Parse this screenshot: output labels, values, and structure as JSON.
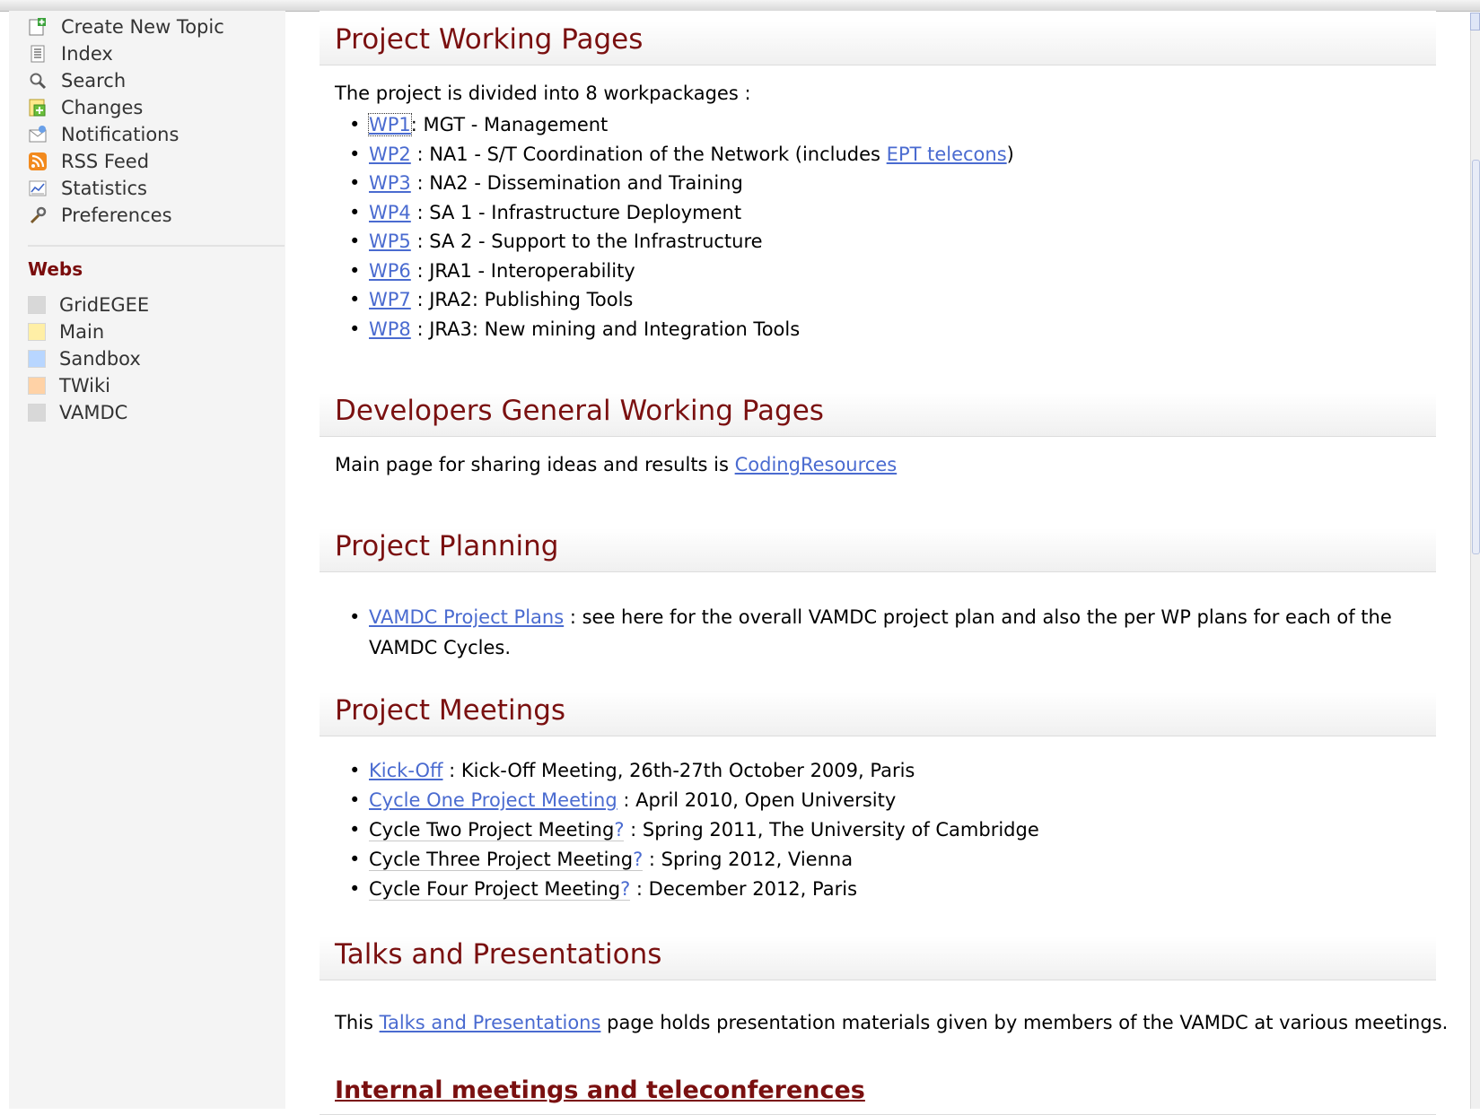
{
  "sidebar": {
    "tools": [
      {
        "label": "Create New Topic",
        "icon": "create-topic-icon"
      },
      {
        "label": "Index",
        "icon": "index-icon"
      },
      {
        "label": "Search",
        "icon": "search-icon"
      },
      {
        "label": "Changes",
        "icon": "changes-icon"
      },
      {
        "label": "Notifications",
        "icon": "notifications-icon"
      },
      {
        "label": "RSS Feed",
        "icon": "rss-icon"
      },
      {
        "label": "Statistics",
        "icon": "statistics-icon"
      },
      {
        "label": "Preferences",
        "icon": "wrench-icon"
      }
    ],
    "webs_title": "Webs",
    "webs": [
      {
        "label": "GridEGEE",
        "color": "#d8d8d8"
      },
      {
        "label": "Main",
        "color": "#ffefa6"
      },
      {
        "label": "Sandbox",
        "color": "#b8d6ff"
      },
      {
        "label": "TWiki",
        "color": "#ffd2a6"
      },
      {
        "label": "VAMDC",
        "color": "#d8d8d8"
      }
    ]
  },
  "sections": {
    "working": {
      "title": "Project Working Pages",
      "intro": "The project is divided into 8 workpackages :",
      "items": [
        {
          "link": "WP1",
          "text": ": MGT - Management"
        },
        {
          "link": "WP2",
          "text": " : NA1 - S/T Coordination of the Network (includes ",
          "link2": "EPT telecons",
          "text2": ")"
        },
        {
          "link": "WP3",
          "text": " : NA2 - Dissemination and Training"
        },
        {
          "link": "WP4",
          "text": " : SA 1 - Infrastructure Deployment"
        },
        {
          "link": "WP5",
          "text": " : SA 2 - Support to the Infrastructure"
        },
        {
          "link": "WP6",
          "text": " : JRA1 - Interoperability"
        },
        {
          "link": "WP7",
          "text": " : JRA2: Publishing Tools"
        },
        {
          "link": "WP8",
          "text": " : JRA3: New mining and Integration Tools"
        }
      ]
    },
    "developers": {
      "title": "Developers General Working Pages",
      "text": "Main page for sharing ideas and results is ",
      "link": "CodingResources"
    },
    "planning": {
      "title": "Project Planning",
      "link": "VAMDC Project Plans",
      "text1": " : see here for the overall VAMDC project plan and also the per WP plans for each of the",
      "text2": "VAMDC Cycles."
    },
    "meetings": {
      "title": "Project Meetings",
      "item1_link": "Kick-Off",
      "item1_text": " : Kick-Off Meeting, 26th-27th October 2009, Paris",
      "item2_link": "Cycle One Project Meeting",
      "item2_text": " : April 2010, Open University",
      "item3_topic": "Cycle Two Project Meeting",
      "item3_text": " : Spring 2011, The University of Cambridge",
      "item4_topic": "Cycle Three Project Meeting",
      "item4_text": " : Spring 2012, Vienna",
      "item5_topic": "Cycle Four Project Meeting",
      "item5_text": " : December 2012, Paris",
      "qmark": "?"
    },
    "talks": {
      "title": "Talks and Presentations",
      "pre": "This ",
      "link": "Talks and Presentations",
      "post": " page holds presentation materials given by members of the VAMDC at various meetings."
    },
    "internal": {
      "title": "Internal meetings and teleconferences"
    }
  }
}
